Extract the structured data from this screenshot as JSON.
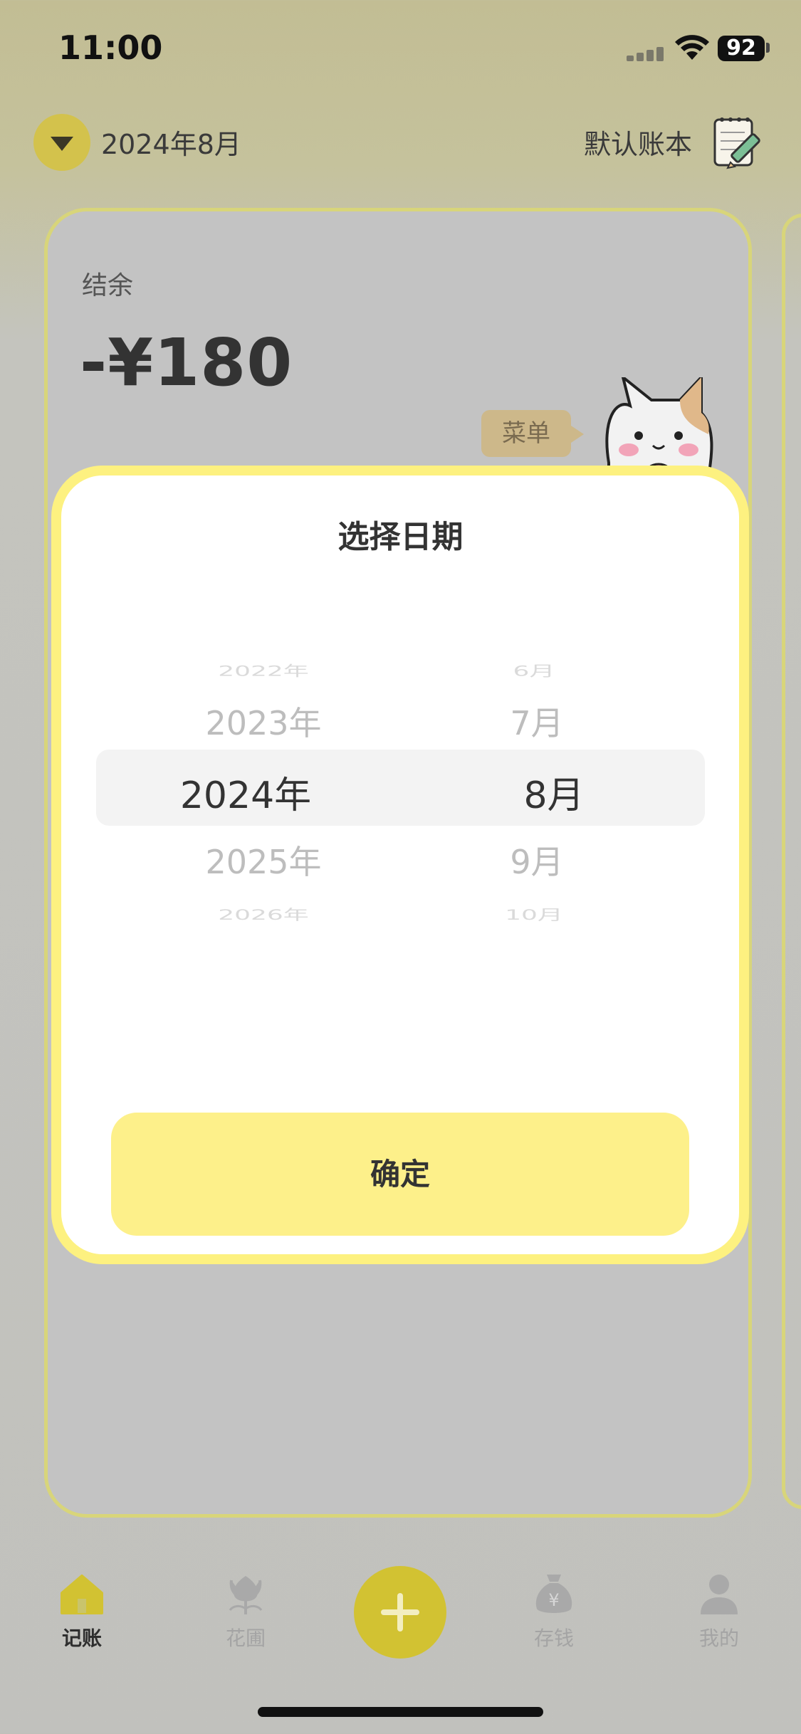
{
  "status_bar": {
    "time": "11:00",
    "battery": "92"
  },
  "header": {
    "date": "2024年8月",
    "book": "默认账本"
  },
  "card": {
    "balance_label": "结余",
    "balance_value": "-¥180",
    "menu_bubble": "菜单"
  },
  "date_picker": {
    "title": "选择日期",
    "years": [
      "2022年",
      "2023年",
      "2024年",
      "2025年",
      "2026年"
    ],
    "months": [
      "6月",
      "7月",
      "8月",
      "9月",
      "10月"
    ],
    "selected_year": "2024年",
    "selected_month": "8月",
    "confirm_label": "确定"
  },
  "tab_bar": {
    "items": [
      {
        "label": "记账",
        "icon": "home-icon",
        "active": true
      },
      {
        "label": "花圃",
        "icon": "flower-icon",
        "active": false
      },
      {
        "label": "存钱",
        "icon": "money-bag-icon",
        "active": false
      },
      {
        "label": "我的",
        "icon": "user-icon",
        "active": false
      }
    ],
    "add_icon": "plus-icon"
  },
  "colors": {
    "accent": "#fdf08a",
    "modal_border": "#fdf180",
    "add_button": "#d2c232",
    "tab_active_icon": "#d2c232"
  }
}
